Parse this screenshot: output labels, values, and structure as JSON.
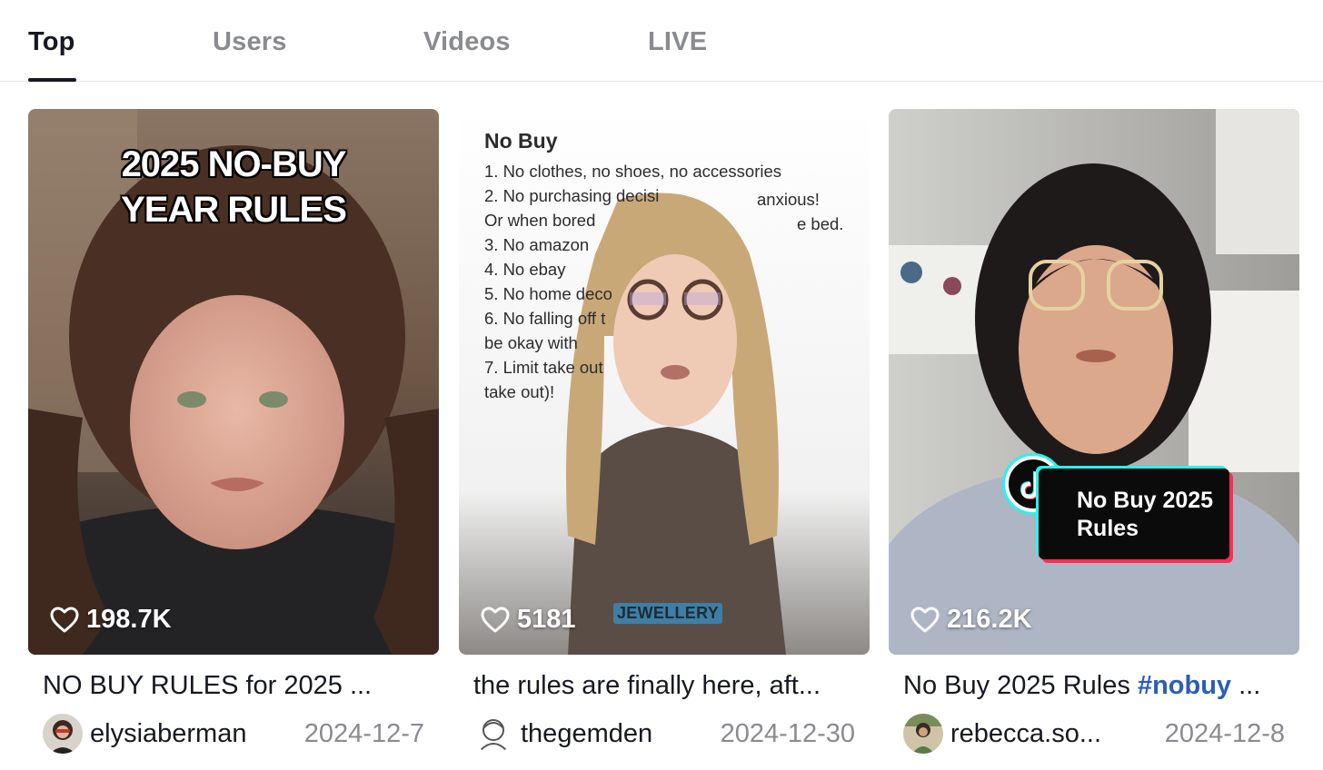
{
  "tabs": [
    {
      "label": "Top",
      "active": true
    },
    {
      "label": "Users",
      "active": false
    },
    {
      "label": "Videos",
      "active": false
    },
    {
      "label": "LIVE",
      "active": false
    }
  ],
  "cards": [
    {
      "overlay_title_line1": "2025 NO-BUY",
      "overlay_title_line2": "YEAR RULES",
      "likes": "198.7K",
      "caption": "NO BUY RULES for 2025 ...",
      "username": "elysiaberman",
      "date": "2024-12-7"
    },
    {
      "doc_title": "No Buy",
      "doc_lines": [
        "1.  No clothes, no shoes, no accessories",
        "2.  No purchasing decisi",
        "        Or when bored",
        "3.  No amazon",
        "4.  No ebay",
        "5.  No home deco",
        "6.  No falling off t",
        "      be okay with",
        "7.  Limit take out",
        "      take out)!"
      ],
      "doc_fragments": [
        "anxious!",
        "e bed."
      ],
      "tag": "JEWELLERY",
      "likes": "5181",
      "caption": "the rules are finally here, aft...",
      "username": "thegemden",
      "date": "2024-12-30"
    },
    {
      "sticker_line1": "No Buy 2025",
      "sticker_line2": "Rules",
      "likes": "216.2K",
      "caption_text": "No Buy 2025 Rules ",
      "caption_tag": "#nobuy",
      "caption_tail": " ...",
      "username": "rebecca.so...",
      "date": "2024-12-8"
    }
  ]
}
